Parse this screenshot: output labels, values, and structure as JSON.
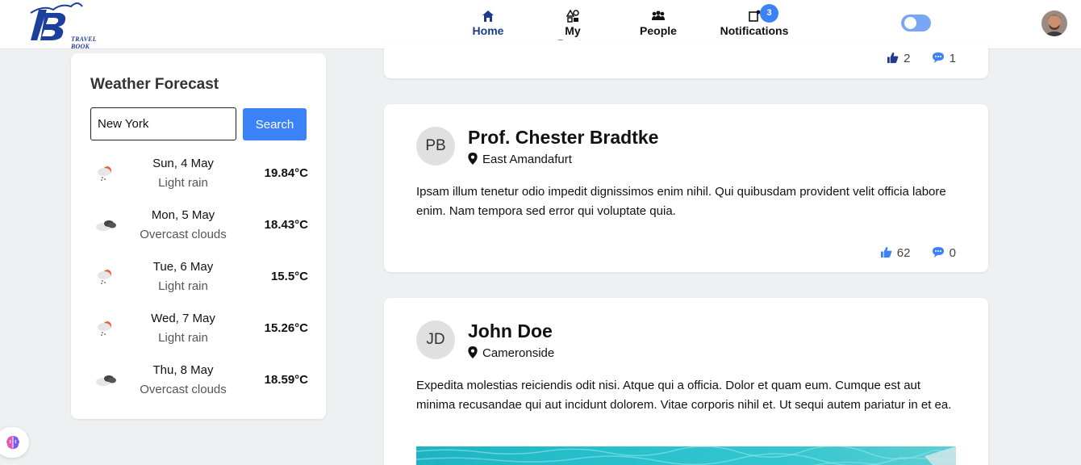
{
  "app": {
    "logo_text": "TRAVEL BOOK"
  },
  "nav": {
    "items": [
      {
        "label": "Home",
        "icon": "home-icon",
        "active": true
      },
      {
        "label": "My Posts",
        "icon": "my-posts-icon",
        "active": false
      },
      {
        "label": "People",
        "icon": "people-icon",
        "active": false
      },
      {
        "label": "Notifications",
        "icon": "notifications-icon",
        "active": false
      }
    ],
    "notification_count": "3",
    "toggle_icon": "theme-toggle",
    "avatar_icon": "user-avatar"
  },
  "weather": {
    "title": "Weather Forecast",
    "city_value": "New York",
    "search_label": "Search",
    "days": [
      {
        "date": "Sun, 4 May",
        "desc": "Light rain",
        "temp": "19.84°C",
        "icon": "rain-icon"
      },
      {
        "date": "Mon, 5 May",
        "desc": "Overcast clouds",
        "temp": "18.43°C",
        "icon": "cloud-icon"
      },
      {
        "date": "Tue, 6 May",
        "desc": "Light rain",
        "temp": "15.5°C",
        "icon": "rain-icon"
      },
      {
        "date": "Wed, 7 May",
        "desc": "Light rain",
        "temp": "15.26°C",
        "icon": "rain-icon"
      },
      {
        "date": "Thu, 8 May",
        "desc": "Overcast clouds",
        "temp": "18.59°C",
        "icon": "cloud-icon"
      }
    ]
  },
  "feed": {
    "prev_post": {
      "likes": "2",
      "comments": "1"
    },
    "posts": [
      {
        "initials": "PB",
        "name": "Prof. Chester Bradtke",
        "location": "East Amandafurt",
        "body": "Ipsam illum tenetur odio impedit dignissimos enim nihil. Qui quibusdam provident velit officia labore enim. Nam tempora sed error qui voluptate quia.",
        "likes": "62",
        "comments": "0"
      },
      {
        "initials": "JD",
        "name": "John Doe",
        "location": "Cameronside",
        "body": "Expedita molestias reiciendis odit nisi. Atque qui a officia. Dolor et quam eum. Cumque est aut minima recusandae qui aut incidunt dolorem. Vitae corporis nihil et. Ut sequi autem pariatur in et ea."
      }
    ]
  },
  "colors": {
    "accent": "#3b82f6",
    "nav_active": "#1e3a8a",
    "like_icon": "#1e3a8a",
    "comment_icon": "#3b82f6"
  }
}
